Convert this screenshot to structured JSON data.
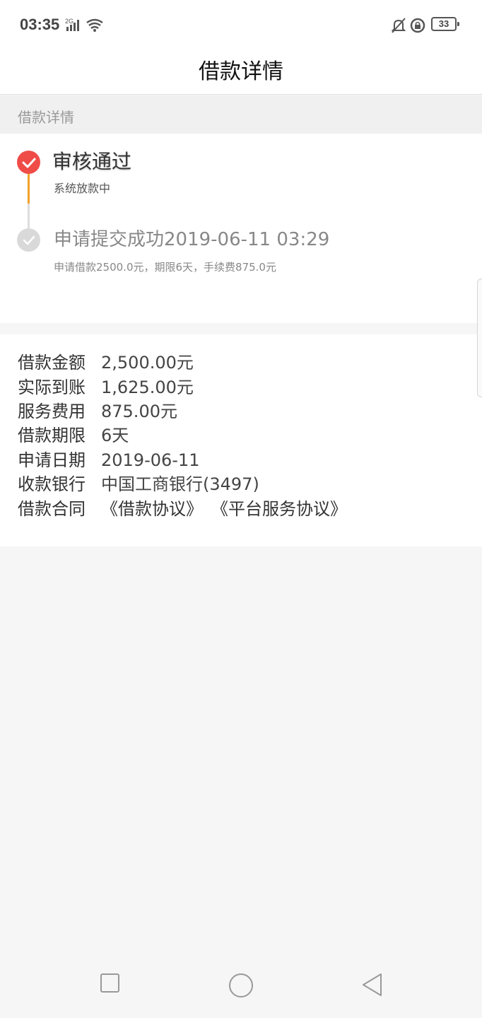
{
  "status_bar": {
    "time": "03:35",
    "network_label": "2G",
    "battery_level": "33",
    "icons": [
      "signal-icon",
      "wifi-icon",
      "mute-bell-icon",
      "rotation-lock-icon",
      "battery-icon"
    ]
  },
  "header": {
    "title": "借款详情"
  },
  "section": {
    "label": "借款详情"
  },
  "timeline": {
    "steps": [
      {
        "title": "审核通过",
        "subtitle": "系统放款中",
        "status": "active"
      },
      {
        "title": "申请提交成功2019-06-11 03:29",
        "subtitle": "申请借款2500.0元，期限6天，手续费875.0元",
        "status": "done"
      }
    ]
  },
  "details": {
    "rows": [
      {
        "label": "借款金额",
        "value": "2,500.00元"
      },
      {
        "label": "实际到账",
        "value": "1,625.00元"
      },
      {
        "label": "服务费用",
        "value": "875.00元"
      },
      {
        "label": "借款期限",
        "value": "6天"
      },
      {
        "label": "申请日期",
        "value": "2019-06-11"
      },
      {
        "label": "收款银行",
        "value": "中国工商银行(3497)"
      }
    ],
    "contract_label": "借款合同",
    "contracts": [
      "《借款协议》",
      "《平台服务协议》"
    ]
  },
  "colors": {
    "active_dot": "#ef4c48",
    "progress_line": "#f0a22a",
    "done_dot": "#d9d9d9",
    "page_background": "#f6f6f6"
  },
  "nav_bar": {
    "buttons": [
      "recent-apps-icon",
      "home-icon",
      "back-icon"
    ]
  }
}
